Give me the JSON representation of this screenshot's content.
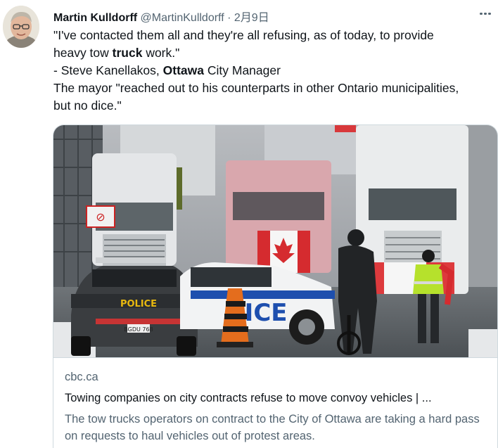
{
  "author": {
    "name": "Martin Kulldorff",
    "handle": "@MartinKulldorff",
    "separator": "·",
    "date": "2月9日"
  },
  "icons": {
    "more": "more-options-icon"
  },
  "tweet": {
    "line1": "\"I've contacted them all and they're all refusing, as of today, to provide",
    "line2_pre": "heavy tow ",
    "line2_bold": "truck",
    "line2_post": " work.\"",
    "line3_pre": "- Steve Kanellakos, ",
    "line3_bold": "Ottawa",
    "line3_post": " City Manager",
    "line4": "The mayor \"reached out to his counterparts in other Ontario municipalities,",
    "line5": "but no dice.\""
  },
  "image": {
    "police_label": "POLICE",
    "car_door_text": "LICE",
    "plate": "BGDU 768",
    "sign_text": "⊘"
  },
  "card": {
    "domain": "cbc.ca",
    "title": "Towing companies on city contracts refuse to move convoy vehicles | ...",
    "description": "The tow trucks operators on contract to the City of Ottawa are taking a hard pass on requests to haul vehicles out of protest areas."
  },
  "colors": {
    "text": "#0f1419",
    "secondary": "#536471",
    "border": "#cfd9de"
  }
}
